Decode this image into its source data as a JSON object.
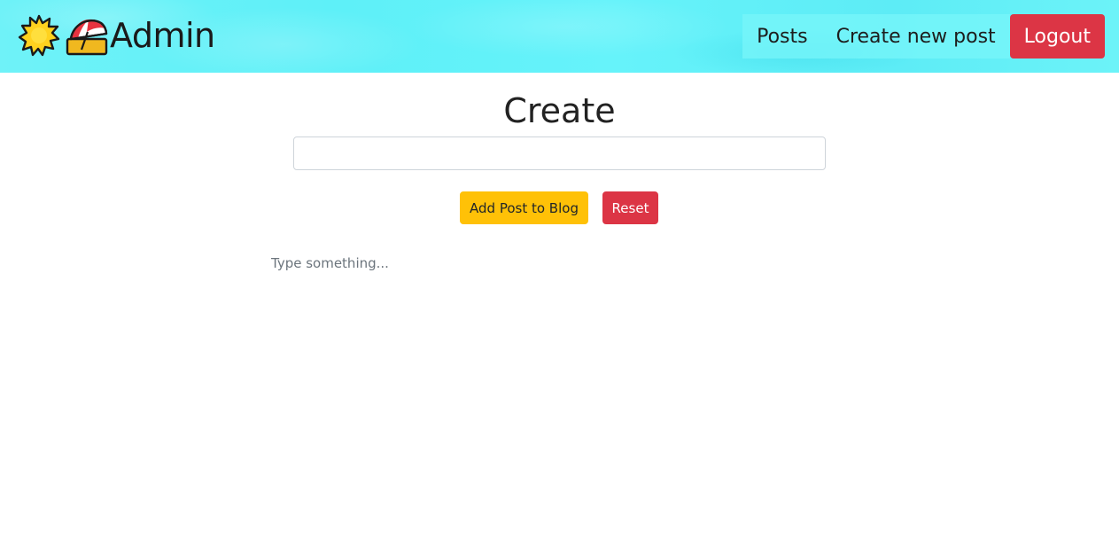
{
  "header": {
    "brand_text": "Admin",
    "brand_icons": [
      "sun-icon",
      "beach-umbrella-icon"
    ],
    "background_color": "#62f0f8"
  },
  "nav": {
    "posts_label": "Posts",
    "create_label": "Create new post",
    "logout_label": "Logout"
  },
  "main": {
    "title": "Create",
    "title_input_value": "",
    "add_button_label": "Add Post to Blog",
    "reset_button_label": "Reset",
    "editor_placeholder": "Type something..."
  },
  "colors": {
    "warning": "#ffc107",
    "danger": "#dc3545"
  }
}
